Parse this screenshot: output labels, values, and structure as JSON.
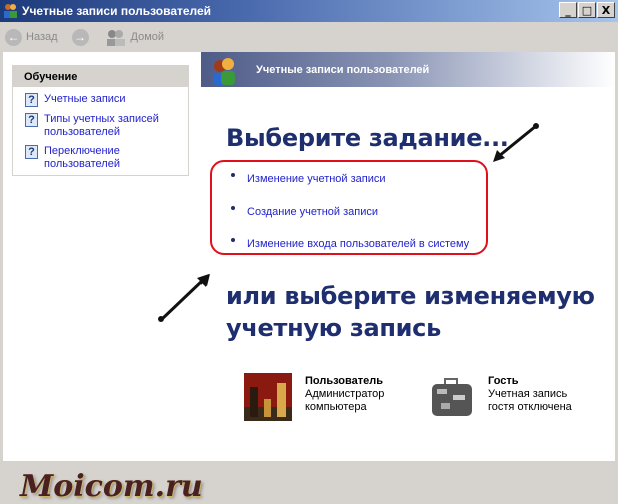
{
  "window": {
    "title": "Учетные записи пользователей",
    "minimize": "_",
    "maximize": "□",
    "close": "X"
  },
  "toolbar": {
    "back": "Назад",
    "home": "Домой"
  },
  "sidebar": {
    "title": "Обучение",
    "items": [
      {
        "label": "Учетные записи"
      },
      {
        "label": "Типы учетных записей пользователей"
      },
      {
        "label": "Переключение пользователей"
      }
    ]
  },
  "header": {
    "title": "Учетные записи пользователей"
  },
  "main": {
    "heading": "Выберите задание...",
    "tasks": [
      {
        "label": "Изменение учетной записи"
      },
      {
        "label": "Создание учетной записи"
      },
      {
        "label": "Изменение входа пользователей в систему"
      }
    ],
    "subheading_line1": "или выберите изменяемую",
    "subheading_line2": "учетную запись"
  },
  "accounts": [
    {
      "name": "Пользователь",
      "role_line1": "Администратор",
      "role_line2": "компьютера"
    },
    {
      "name": "Гость",
      "role_line1": "Учетная запись",
      "role_line2": "гостя отключена"
    }
  ],
  "watermark": "Moicom.ru",
  "colors": {
    "highlight": "#e0101a",
    "heading": "#1e2e6e",
    "link": "#2222cc"
  }
}
